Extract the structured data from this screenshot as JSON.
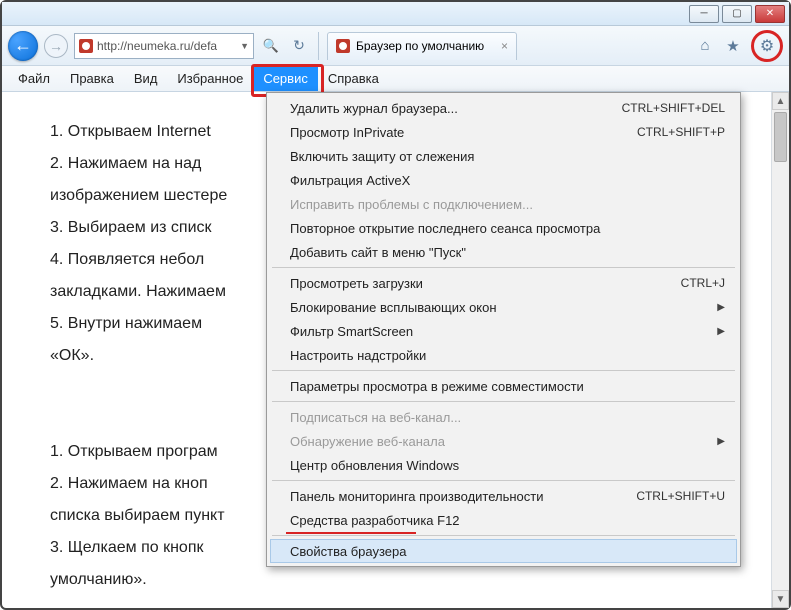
{
  "window": {
    "minimize_tip": "Свернуть",
    "maximize_tip": "Развернуть",
    "close_tip": "Закрыть"
  },
  "nav": {
    "back_tip": "Назад",
    "forward_tip": "Вперёд",
    "url": "http://neumeka.ru/defa",
    "search_tip": "Поиск",
    "refresh_tip": "Обновить",
    "tab_title": "Браузер по умолчанию",
    "home_tip": "Домой",
    "fav_tip": "Избранное",
    "gear_tip": "Сервис"
  },
  "menubar": {
    "items": [
      "Файл",
      "Правка",
      "Вид",
      "Избранное",
      "Сервис",
      "Справка"
    ],
    "active_index": 4
  },
  "dropdown": {
    "items": [
      {
        "label": "Удалить журнал браузера...",
        "shortcut": "CTRL+SHIFT+DEL"
      },
      {
        "label": "Просмотр InPrivate",
        "shortcut": "CTRL+SHIFT+P"
      },
      {
        "label": "Включить защиту от слежения"
      },
      {
        "label": "Фильтрация ActiveX"
      },
      {
        "label": "Исправить проблемы с подключением...",
        "disabled": true
      },
      {
        "label": "Повторное открытие последнего сеанса просмотра"
      },
      {
        "label": "Добавить сайт в меню \"Пуск\""
      },
      {
        "type": "sep"
      },
      {
        "label": "Просмотреть загрузки",
        "shortcut": "CTRL+J"
      },
      {
        "label": "Блокирование всплывающих окон",
        "submenu": true
      },
      {
        "label": "Фильтр SmartScreen",
        "submenu": true
      },
      {
        "label": "Настроить надстройки"
      },
      {
        "type": "sep"
      },
      {
        "label": "Параметры просмотра в режиме совместимости"
      },
      {
        "type": "sep"
      },
      {
        "label": "Подписаться на веб-канал...",
        "disabled": true
      },
      {
        "label": "Обнаружение веб-канала",
        "disabled": true,
        "submenu": true
      },
      {
        "label": "Центр обновления Windows"
      },
      {
        "type": "sep"
      },
      {
        "label": "Панель мониторинга производительности",
        "shortcut": "CTRL+SHIFT+U"
      },
      {
        "label": "Средства разработчика F12"
      },
      {
        "type": "sep"
      },
      {
        "label": "Свойства браузера",
        "hover": true
      }
    ]
  },
  "page": {
    "lines": [
      "1.  Открываем Internet",
      "2.  Нажимаем на над",
      "изображением шестере",
      "3.  Выбираем из списк",
      "4.  Появляется небол",
      "закладками. Нажимаем",
      "5.  Внутри нажимаем",
      "«ОК».",
      "",
      "",
      "1.  Открываем програм",
      "2.  Нажимаем на кноп",
      "списка выбираем пункт",
      "3.  Щелкаем по кнопк",
      "умолчанию»."
    ]
  }
}
